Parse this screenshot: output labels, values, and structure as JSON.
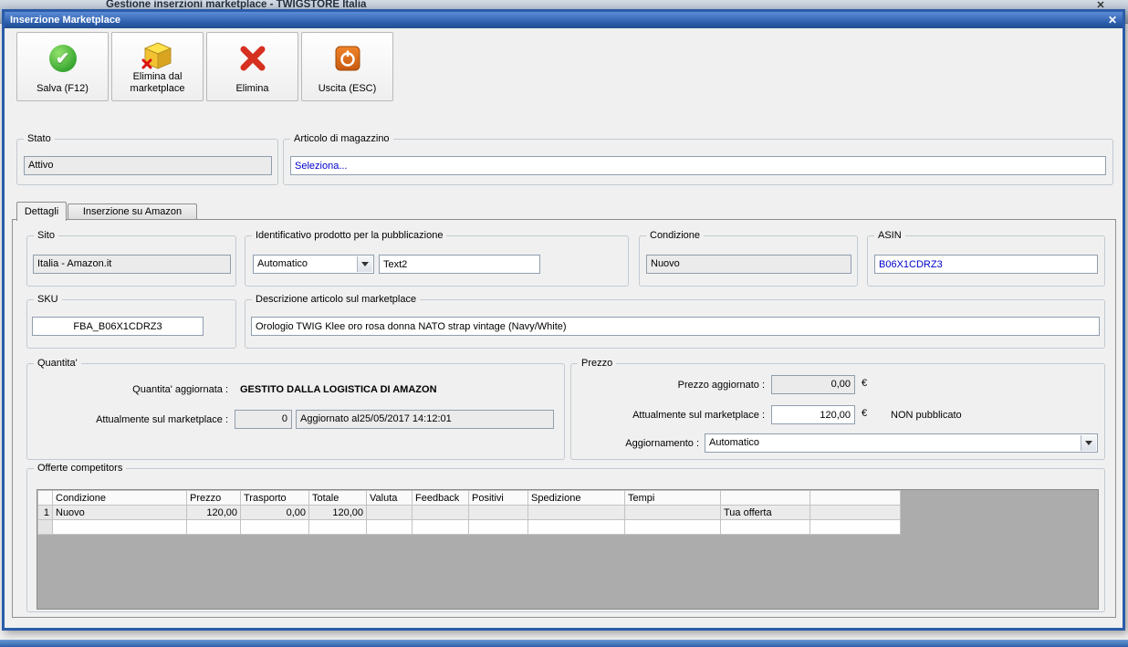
{
  "icons": {
    "check": "✔",
    "close": "✕"
  },
  "colors": {
    "title_bar_blue": "#2a5caa",
    "link_blue": "#0000cc",
    "save_green": "#3aa832",
    "delete_red": "#d63020"
  },
  "background_window": {
    "title": "Gestione inserzioni marketplace - TWIGSTORE Italia"
  },
  "dialog": {
    "title": "Inserzione Marketplace"
  },
  "toolbar": {
    "save_label": "Salva (F12)",
    "delete_marketplace_label": "Elimina dal marketplace",
    "delete_label": "Elimina",
    "exit_label": "Uscita (ESC)"
  },
  "stato": {
    "label": "Stato",
    "value": "Attivo"
  },
  "articolo": {
    "label": "Articolo di magazzino",
    "value": "Seleziona..."
  },
  "tabs": {
    "dettagli": "Dettagli",
    "amazon": "Inserzione su Amazon"
  },
  "sito": {
    "label": "Sito",
    "value": "Italia - Amazon.it"
  },
  "identificativo": {
    "label": "Identificativo prodotto per la pubblicazione",
    "combo_value": "Automatico",
    "text_value": "Text2"
  },
  "condizione": {
    "label": "Condizione",
    "value": "Nuovo"
  },
  "asin": {
    "label": "ASIN",
    "value": "B06X1CDRZ3"
  },
  "sku": {
    "label": "SKU",
    "value": "FBA_B06X1CDRZ3"
  },
  "descrizione": {
    "label": "Descrizione articolo sul marketplace",
    "value": "Orologio TWIG Klee oro rosa donna NATO strap vintage (Navy/White)"
  },
  "quantita": {
    "label": "Quantita'",
    "row1_label": "Quantita' aggiornata :",
    "row1_value": "GESTITO DALLA LOGISTICA DI AMAZON",
    "row2_label": "Attualmente sul marketplace :",
    "row2_value": "0",
    "row2_info": "Aggiornato al25/05/2017 14:12:01"
  },
  "prezzo": {
    "label": "Prezzo",
    "row1_label": "Prezzo aggiornato :",
    "row1_value": "0,00",
    "row1_currency": "€",
    "row2_label": "Attualmente sul marketplace :",
    "row2_value": "120,00",
    "row2_currency": "€",
    "row2_status": "NON pubblicato",
    "row3_label": "Aggiornamento :",
    "row3_value": "Automatico"
  },
  "offerte": {
    "label": "Offerte competitors",
    "columns": [
      "",
      "Condizione",
      "Prezzo",
      "Trasporto",
      "Totale",
      "Valuta",
      "Feedback",
      "Positivi",
      "Spedizione",
      "Tempi",
      "",
      ""
    ],
    "row1": {
      "num": "1",
      "condizione": "Nuovo",
      "prezzo": "120,00",
      "trasporto": "0,00",
      "totale": "120,00",
      "offerta": "Tua offerta"
    }
  }
}
